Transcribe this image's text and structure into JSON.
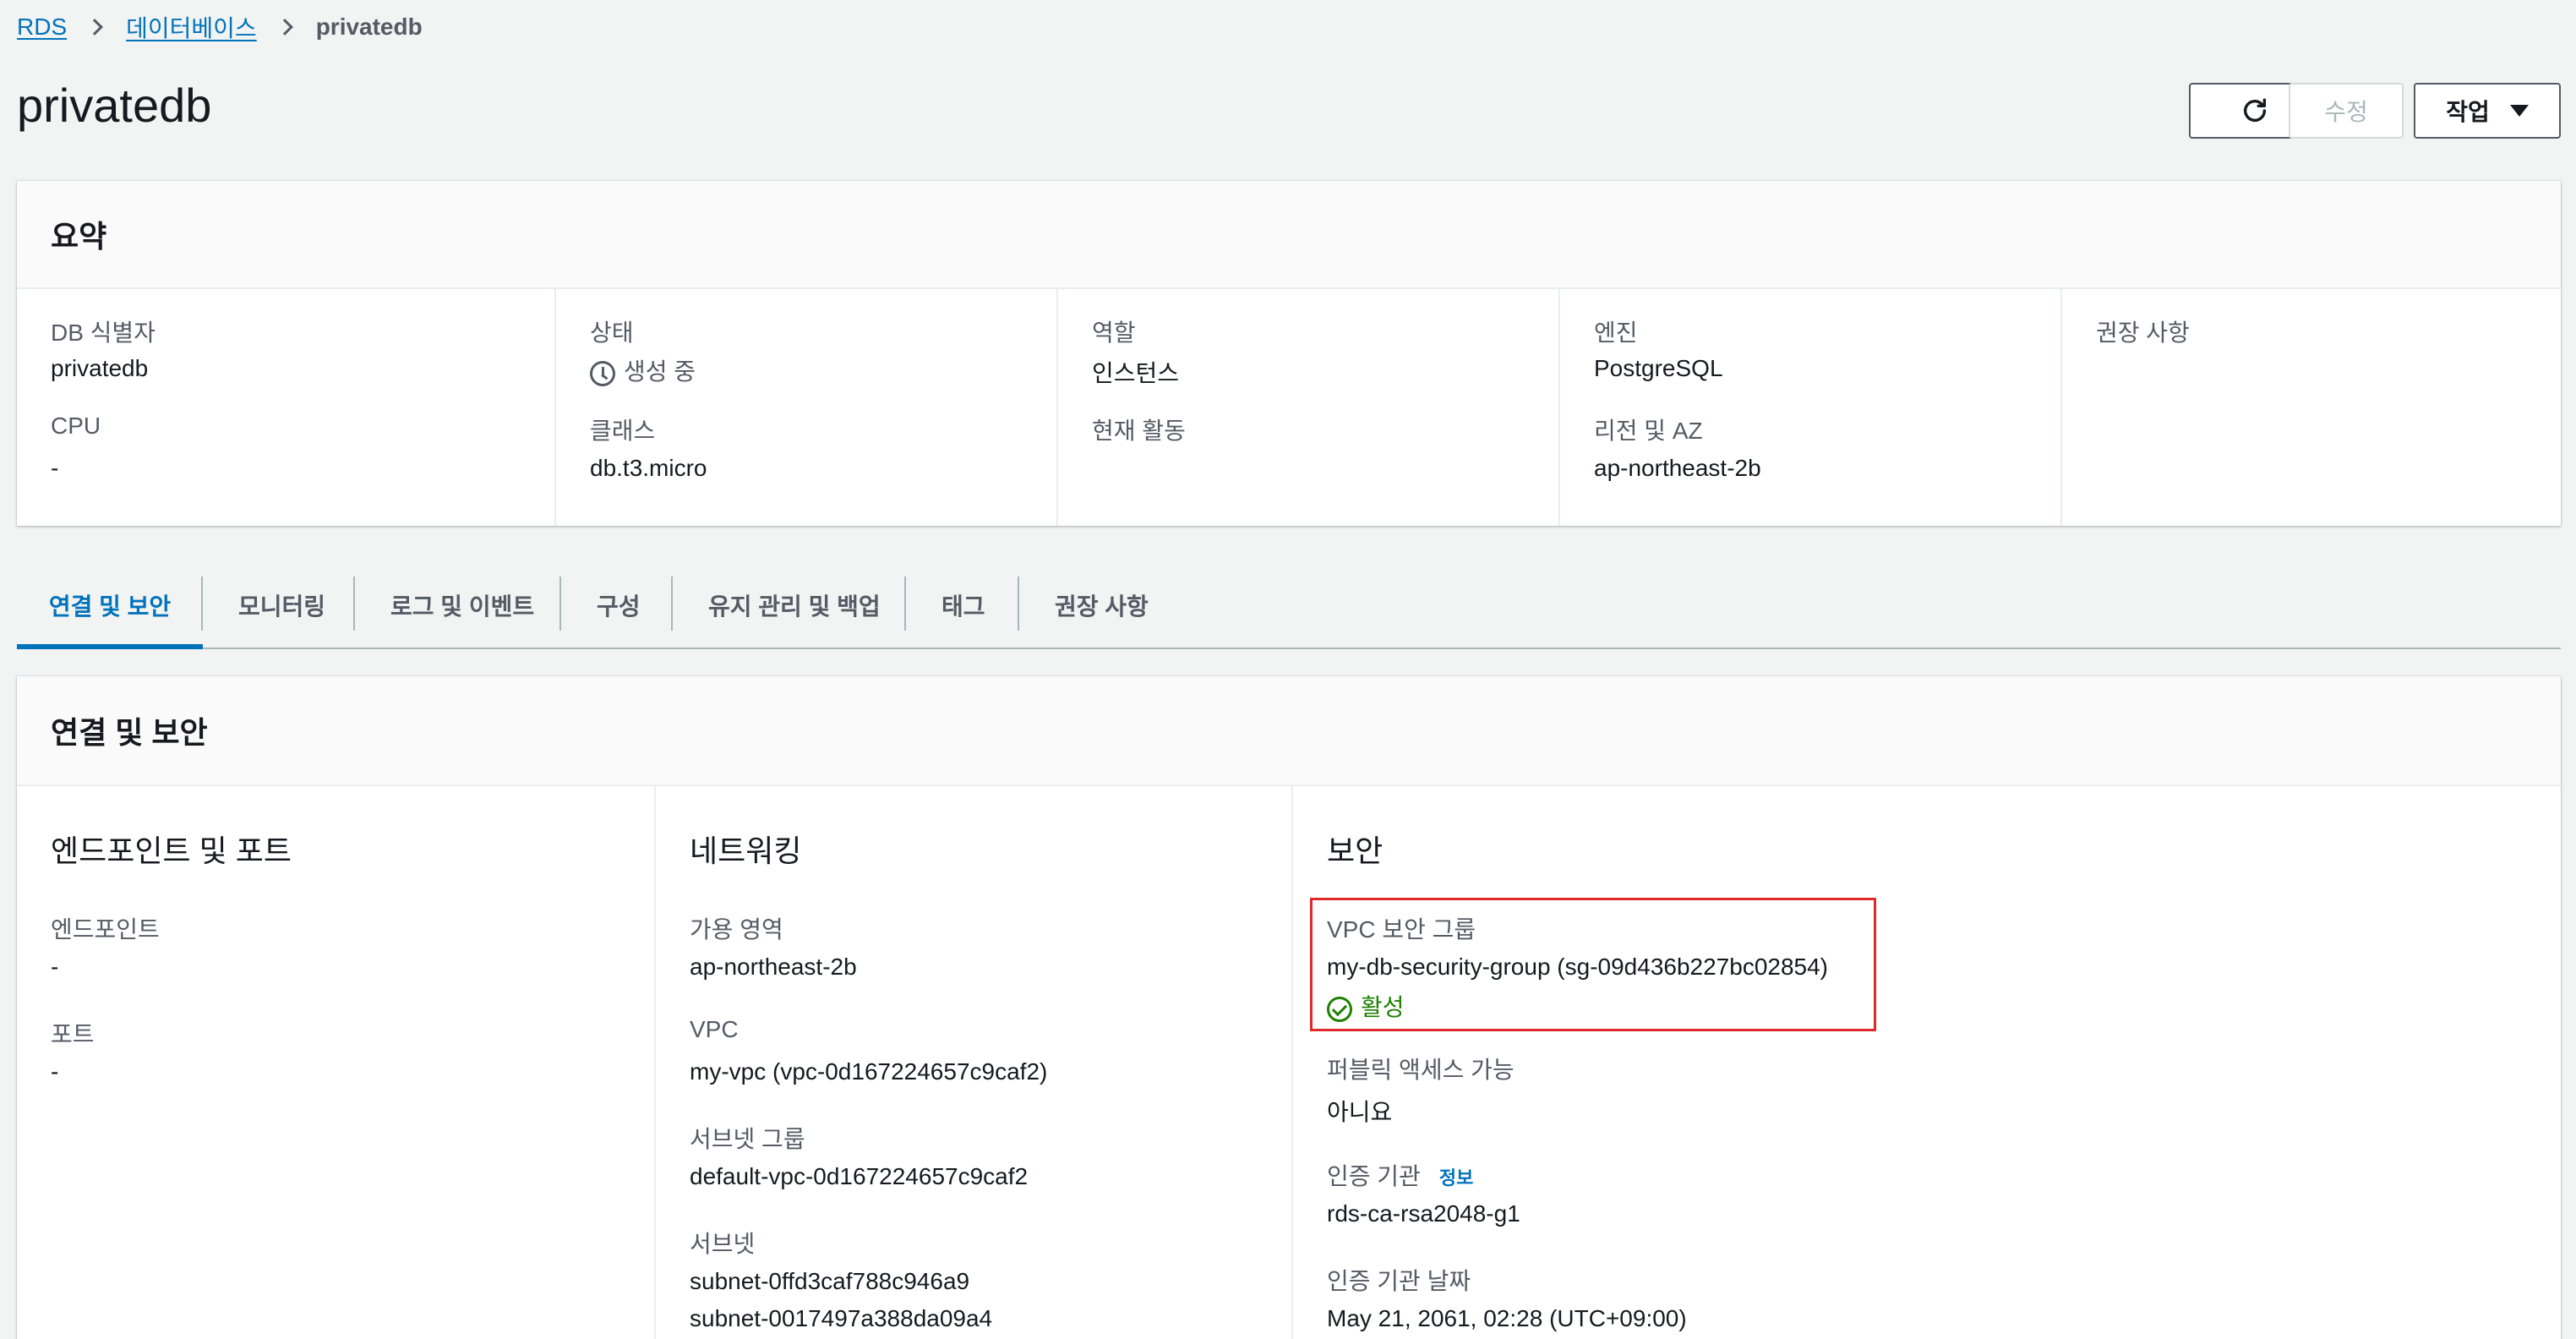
{
  "breadcrumb": {
    "root": "RDS",
    "databases": "데이터베이스",
    "current": "privatedb"
  },
  "page_title": "privatedb",
  "header_buttons": {
    "refresh_icon": "refresh-icon",
    "edit": "수정",
    "actions": "작업"
  },
  "summary": {
    "title": "요약",
    "db_identifier_label": "DB 식별자",
    "db_identifier_value": "privatedb",
    "cpu_label": "CPU",
    "cpu_value": "-",
    "status_label": "상태",
    "status_value": "생성 중",
    "class_label": "클래스",
    "class_value": "db.t3.micro",
    "role_label": "역할",
    "role_value": "인스턴스",
    "current_activity_label": "현재 활동",
    "engine_label": "엔진",
    "engine_value": "PostgreSQL",
    "region_label": "리전 및 AZ",
    "region_value": "ap-northeast-2b",
    "recommendations_label": "권장 사항"
  },
  "tabs": [
    {
      "label": "연결 및 보안",
      "active": true
    },
    {
      "label": "모니터링"
    },
    {
      "label": "로그 및 이벤트"
    },
    {
      "label": "구성"
    },
    {
      "label": "유지 관리 및 백업"
    },
    {
      "label": "태그"
    },
    {
      "label": "권장 사항"
    }
  ],
  "connectivity": {
    "title": "연결 및 보안",
    "endpoint_section": {
      "title": "엔드포인트 및 포트",
      "endpoint_label": "엔드포인트",
      "endpoint_value": "-",
      "port_label": "포트",
      "port_value": "-"
    },
    "networking_section": {
      "title": "네트워킹",
      "az_label": "가용 영역",
      "az_value": "ap-northeast-2b",
      "vpc_label": "VPC",
      "vpc_value": "my-vpc (vpc-0d167224657c9caf2)",
      "subnet_group_label": "서브넷 그룹",
      "subnet_group_value": "default-vpc-0d167224657c9caf2",
      "subnets_label": "서브넷",
      "subnets": [
        "subnet-0ffd3caf788c946a9",
        "subnet-0017497a388da09a4"
      ]
    },
    "security_section": {
      "title": "보안",
      "vpc_sg_label": "VPC 보안 그룹",
      "vpc_sg_value": "my-db-security-group (sg-09d436b227bc02854)",
      "vpc_sg_status": "활성",
      "public_access_label": "퍼블릭 액세스 가능",
      "public_access_value": "아니요",
      "ca_label": "인증 기관",
      "ca_info": "정보",
      "ca_value": "rds-ca-rsa2048-g1",
      "ca_date_label": "인증 기관 날짜",
      "ca_date_value": "May 21, 2061, 02:28 (UTC+09:00)"
    }
  },
  "colors": {
    "link": "#0073bb",
    "success": "#1d8102",
    "highlight": "#e02a2a"
  }
}
